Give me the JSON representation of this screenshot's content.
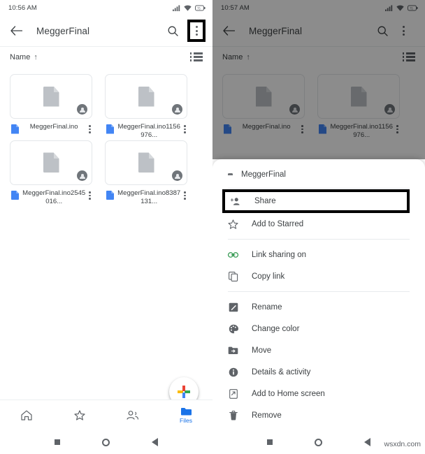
{
  "left": {
    "status": {
      "time": "10:56 AM",
      "icons": [
        "signal-icon",
        "wifi-icon",
        "battery-icon"
      ]
    },
    "appbar": {
      "back": "back-arrow-icon",
      "title": "MeggerFinal",
      "search": "search-icon",
      "overflow": "overflow-menu-icon"
    },
    "sort": {
      "label": "Name",
      "direction": "↑",
      "view_toggle": "list-view-icon"
    },
    "files": [
      {
        "name": "MeggerFinal.ino",
        "badge": "shared-avatar-icon"
      },
      {
        "name": "MeggerFinal.ino1156976...",
        "badge": "shared-avatar-icon"
      },
      {
        "name": "MeggerFinal.ino2545016...",
        "badge": "shared-avatar-icon"
      },
      {
        "name": "MeggerFinal.ino8387131...",
        "badge": "shared-avatar-icon"
      }
    ],
    "fab": "add-new-icon",
    "bottom_nav": [
      {
        "label": "",
        "icon": "home-icon",
        "active": false
      },
      {
        "label": "",
        "icon": "star-icon",
        "active": false
      },
      {
        "label": "",
        "icon": "shared-icon",
        "active": false
      },
      {
        "label": "Files",
        "icon": "files-folder-icon",
        "active": true
      }
    ],
    "system_nav": [
      "square-icon",
      "circle-icon",
      "triangle-back-icon"
    ]
  },
  "right": {
    "status": {
      "time": "10:57 AM",
      "icons": [
        "signal-icon",
        "wifi-icon",
        "battery-icon"
      ]
    },
    "appbar": {
      "back": "back-arrow-icon",
      "title": "MeggerFinal",
      "search": "search-icon",
      "overflow": "overflow-menu-icon"
    },
    "sort": {
      "label": "Name",
      "direction": "↑",
      "view_toggle": "list-view-icon"
    },
    "files": [
      {
        "name": "MeggerFinal.ino",
        "badge": "shared-avatar-icon"
      },
      {
        "name": "MeggerFinal.ino1156976...",
        "badge": "shared-avatar-icon"
      }
    ],
    "sheet": {
      "header": {
        "icon": "folder-icon",
        "title": "MeggerFinal"
      },
      "group1": [
        {
          "label": "Share",
          "icon": "person-add-icon",
          "highlighted": true
        },
        {
          "label": "Add to Starred",
          "icon": "star-outline-icon",
          "highlighted": false
        }
      ],
      "group2": [
        {
          "label": "Link sharing on",
          "icon": "link-icon",
          "highlighted": false,
          "color": "#1e8e3e"
        },
        {
          "label": "Copy link",
          "icon": "copy-icon",
          "highlighted": false
        }
      ],
      "group3": [
        {
          "label": "Rename",
          "icon": "rename-pencil-icon",
          "highlighted": false
        },
        {
          "label": "Change color",
          "icon": "palette-icon",
          "highlighted": false
        },
        {
          "label": "Move",
          "icon": "move-folder-icon",
          "highlighted": false
        },
        {
          "label": "Details & activity",
          "icon": "info-icon",
          "highlighted": false
        },
        {
          "label": "Add to Home screen",
          "icon": "add-home-screen-icon",
          "highlighted": false
        },
        {
          "label": "Remove",
          "icon": "trash-icon",
          "highlighted": false
        }
      ]
    },
    "system_nav": [
      "square-icon",
      "circle-icon",
      "triangle-back-icon"
    ]
  },
  "watermark": "wsxdn.com",
  "colors": {
    "accent": "#1a73e8",
    "green": "#1e8e3e",
    "text": "#3c4043",
    "muted": "#5f6368"
  }
}
